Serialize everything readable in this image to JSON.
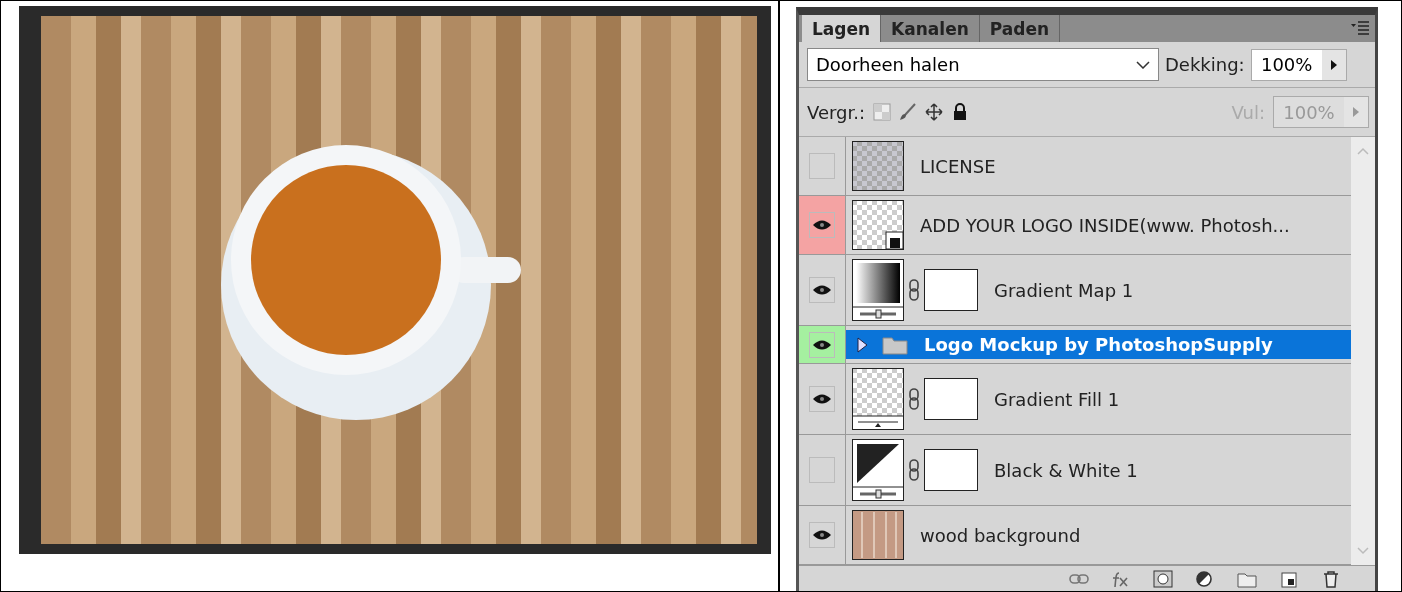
{
  "photo": {
    "kind": "photo"
  },
  "panel": {
    "tabs": [
      {
        "label": "Lagen",
        "selected": true
      },
      {
        "label": "Kanalen",
        "selected": false
      },
      {
        "label": "Paden",
        "selected": false
      }
    ],
    "blend_mode": "Doorheen halen",
    "opacity_label": "Dekking:",
    "opacity": "100%",
    "lock_label": "Vergr.:",
    "fill_label": "Vul:",
    "fill": "100%",
    "fill_disabled": true,
    "layers": [
      {
        "name": "LICENSE",
        "visible": false,
        "kind": "checker",
        "mask": false,
        "selected": false
      },
      {
        "name": "ADD YOUR LOGO INSIDE(www. Photosh...",
        "visible": true,
        "color": "#f4a3a3",
        "kind": "smart",
        "mask": false,
        "selected": false
      },
      {
        "name": "Gradient Map 1",
        "visible": true,
        "kind": "gradient",
        "mask": true,
        "selected": false
      },
      {
        "name": "Logo Mockup by PhotoshopSupply",
        "visible": true,
        "color": "#a5f0a0",
        "kind": "folder",
        "mask": false,
        "selected": true,
        "expanded": false
      },
      {
        "name": "Gradient Fill 1",
        "visible": true,
        "kind": "fill",
        "mask": true,
        "selected": false
      },
      {
        "name": "Black & White 1",
        "visible": false,
        "kind": "bw",
        "mask": true,
        "selected": false
      },
      {
        "name": "wood background",
        "visible": true,
        "kind": "wood",
        "mask": false,
        "selected": false
      }
    ]
  }
}
